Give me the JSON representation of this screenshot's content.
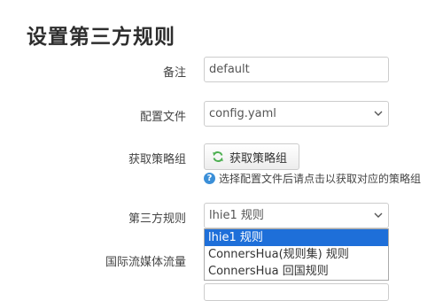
{
  "page": {
    "title": "设置第三方规则"
  },
  "form": {
    "remark": {
      "label": "备注",
      "value": "default"
    },
    "config_file": {
      "label": "配置文件",
      "selected": "config.yaml"
    },
    "get_policy_group": {
      "label": "获取策略组",
      "button_label": "获取策略组",
      "help_text": "选择配置文件后请点击以获取对应的策略组"
    },
    "third_party_rule": {
      "label": "第三方规则",
      "selected": "lhie1 规则",
      "options": [
        "lhie1 规则",
        "ConnersHua(规则集) 规则",
        "ConnersHua 回国规则"
      ],
      "highlighted_index": 0
    },
    "streaming_traffic": {
      "label": "国际流媒体流量"
    }
  },
  "icons": {
    "button_icon": "refresh-icon",
    "help_icon": "question-icon",
    "select_icon": "chevron-down-icon"
  },
  "colors": {
    "highlight": "#1e6fd9",
    "help_icon": "#3b8fd8",
    "refresh_icon": "#4caf50"
  }
}
